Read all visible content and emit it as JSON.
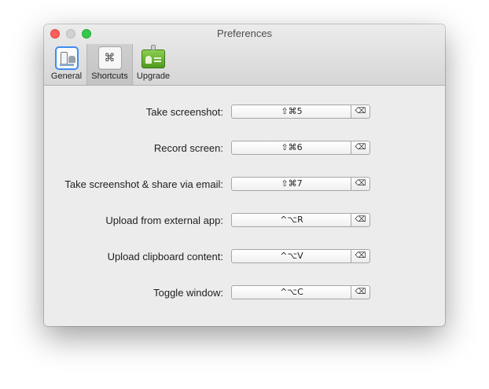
{
  "window": {
    "title": "Preferences"
  },
  "tabs": [
    {
      "label": "General",
      "icon": "general-icon"
    },
    {
      "label": "Shortcuts",
      "icon": "command-key-icon",
      "active": true
    },
    {
      "label": "Upgrade",
      "icon": "upgrade-badge-icon"
    }
  ],
  "shortcuts": [
    {
      "label": "Take screenshot:",
      "keys": "⇧⌘5",
      "clear": "⌫"
    },
    {
      "label": "Record screen:",
      "keys": "⇧⌘6",
      "clear": "⌫"
    },
    {
      "label": "Take screenshot & share via email:",
      "keys": "⇧⌘7",
      "clear": "⌫"
    },
    {
      "label": "Upload from external app:",
      "keys": "^⌥R",
      "clear": "⌫"
    },
    {
      "label": "Upload clipboard content:",
      "keys": "^⌥V",
      "clear": "⌫"
    },
    {
      "label": "Toggle window:",
      "keys": "^⌥C",
      "clear": "⌫"
    }
  ],
  "icons": {
    "shortcuts_glyph": "⌘"
  },
  "colors": {
    "close": "#fc605c",
    "minimize": "#d1d1d1",
    "maximize": "#34c84a",
    "selection": "#3d8ef1"
  }
}
